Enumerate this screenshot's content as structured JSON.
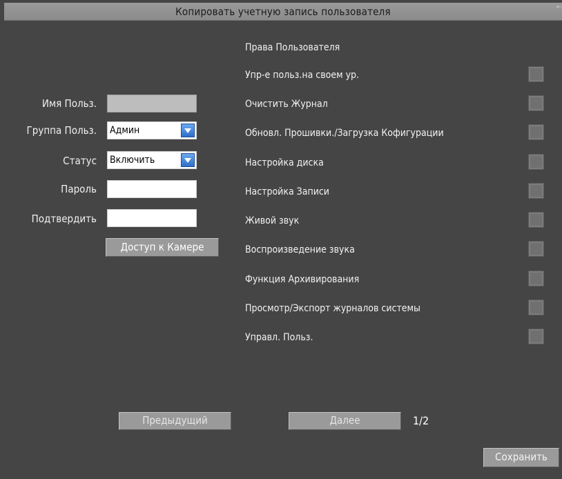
{
  "window": {
    "title": "Копировать учетную запись пользователя"
  },
  "form": {
    "username_label": "Имя Польз.",
    "username_value": "",
    "group_label": "Группа Польз.",
    "group_value": "Админ",
    "status_label": "Статус",
    "status_value": "Включить",
    "password_label": "Пароль",
    "password_value": "",
    "confirm_label": "Подтвердить",
    "confirm_value": "",
    "camera_access_label": "Доступ к Камере"
  },
  "permissions": {
    "header": "Права Пользователя",
    "items": [
      {
        "label": "Упр-е польз.на своем ур.",
        "checked": true
      },
      {
        "label": "Очистить Журнал",
        "checked": true
      },
      {
        "label": "Обновл. Прошивки./Загрузка Кофигурации",
        "checked": true
      },
      {
        "label": "Настройка диска",
        "checked": true
      },
      {
        "label": "Настройка Записи",
        "checked": true
      },
      {
        "label": "Живой звук",
        "checked": true
      },
      {
        "label": "Воспроизведение звука",
        "checked": true
      },
      {
        "label": "Функция Архивирования",
        "checked": true
      },
      {
        "label": "Просмотр/Экспорт журналов системы",
        "checked": true
      },
      {
        "label": "Управл. Польз.",
        "checked": true
      }
    ]
  },
  "footer": {
    "prev_label": "Предыдущий",
    "next_label": "Далее",
    "page": "1/2",
    "save_label": "Сохранить"
  }
}
